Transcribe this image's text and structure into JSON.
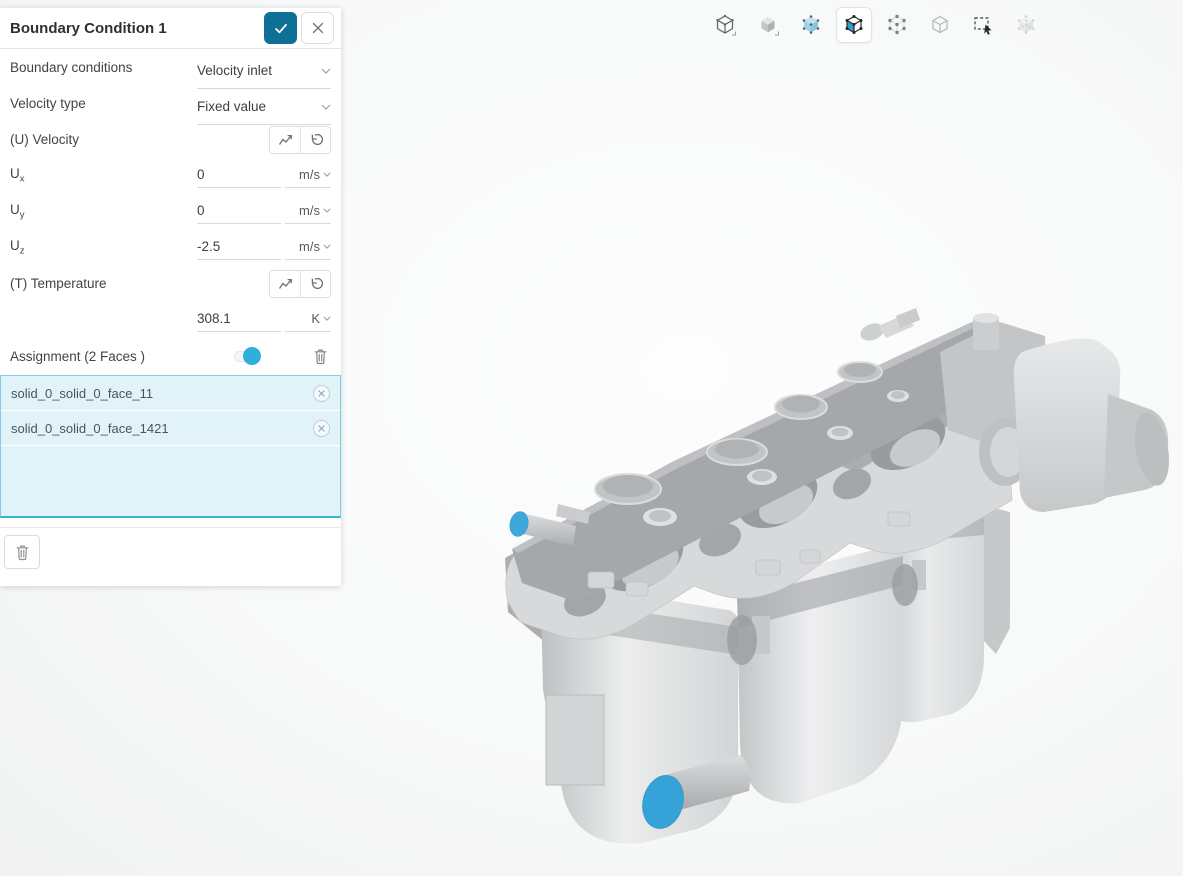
{
  "panel": {
    "title": "Boundary Condition 1",
    "rows": {
      "boundary_conditions": {
        "label": "Boundary conditions",
        "value": "Velocity inlet"
      },
      "velocity_type": {
        "label": "Velocity type",
        "value": "Fixed value"
      },
      "u_velocity": {
        "label": "(U) Velocity"
      },
      "ux": {
        "label_base": "U",
        "label_sub": "x",
        "value": "0",
        "unit": "m/s"
      },
      "uy": {
        "label_base": "U",
        "label_sub": "y",
        "value": "0",
        "unit": "m/s"
      },
      "uz": {
        "label_base": "U",
        "label_sub": "z",
        "value": "-2.5",
        "unit": "m/s"
      },
      "temperature": {
        "label": "(T) Temperature",
        "value": "308.1",
        "unit": "K"
      }
    },
    "assignment": {
      "label": "Assignment (2 Faces )",
      "toggle_state": "on",
      "faces": [
        "solid_0_solid_0_face_11",
        "solid_0_solid_0_face_1421"
      ]
    }
  },
  "toolbar": {
    "tools": [
      {
        "name": "view-cube",
        "state": "normal"
      },
      {
        "name": "shaded-view",
        "state": "normal"
      },
      {
        "name": "select-volume",
        "state": "normal"
      },
      {
        "name": "select-face",
        "state": "active"
      },
      {
        "name": "select-vertex",
        "state": "normal"
      },
      {
        "name": "select-edge",
        "state": "normal"
      },
      {
        "name": "box-select",
        "state": "normal"
      },
      {
        "name": "select-hidden",
        "state": "disabled"
      }
    ]
  },
  "viewport": {
    "model": "engine-manifold-assembly",
    "selected_face_count": 2
  },
  "colors": {
    "accent": "#0e7097",
    "selection_blue": "#35a3d8",
    "assignment_bg": "#e1f3f9",
    "assignment_border": "#35b4d4"
  }
}
